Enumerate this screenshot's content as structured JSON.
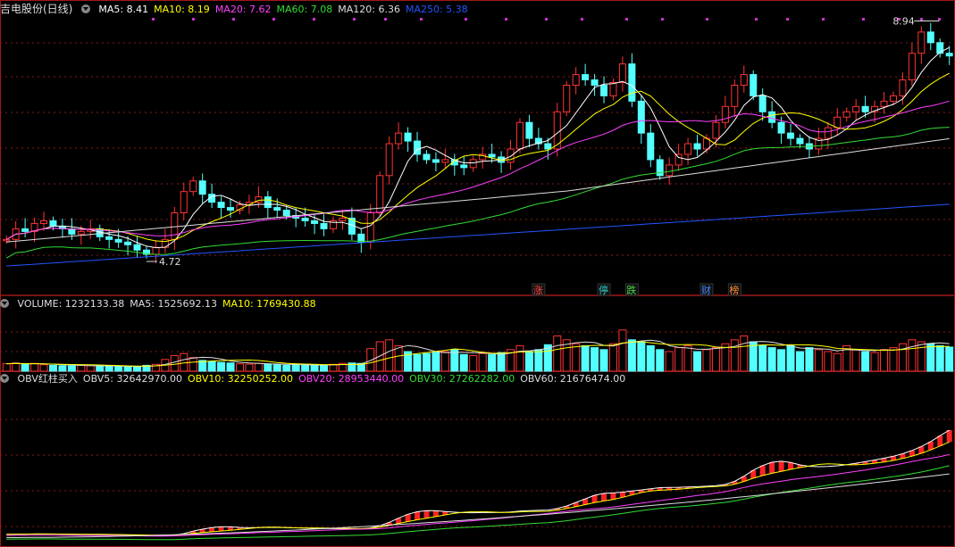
{
  "colors": {
    "up": "#ff3333",
    "down": "#54ffff",
    "ma5": "#ffffff",
    "ma10": "#ffff00",
    "ma20": "#ff40ff",
    "ma60": "#33dd33",
    "ma120": "#dddddd",
    "ma250": "#2255ff",
    "grid": "#8a1a1a",
    "border": "#a01818"
  },
  "price_panel": {
    "title": "吉电股份(日线)",
    "icon": "chevron-down-icon",
    "legend": [
      {
        "label": "MA5: 8.41",
        "color": "#ffffff"
      },
      {
        "label": "MA10: 8.19",
        "color": "#ffff00"
      },
      {
        "label": "MA20: 7.62",
        "color": "#ff40ff"
      },
      {
        "label": "MA60: 7.08",
        "color": "#33dd33"
      },
      {
        "label": "MA120: 6.36",
        "color": "#dddddd"
      },
      {
        "label": "MA250: 5.38",
        "color": "#2255ff"
      }
    ],
    "high_label": "8.94",
    "low_label": "4.72",
    "event_marks": [
      {
        "text": "涨",
        "color": "#ff4444",
        "day": 57
      },
      {
        "text": "停",
        "color": "#33cccc",
        "day": 64
      },
      {
        "text": "跌",
        "color": "#44dd44",
        "day": 67
      },
      {
        "text": "财",
        "color": "#4488ff",
        "day": 75
      },
      {
        "text": "榜",
        "color": "#ff8833",
        "day": 78
      }
    ]
  },
  "volume_panel": {
    "legend": [
      {
        "label": "VOLUME: 1232133.38",
        "color": "#dddddd"
      },
      {
        "label": "MA5: 1525692.13",
        "color": "#dddddd"
      },
      {
        "label": "MA10: 1769430.88",
        "color": "#ffff00"
      }
    ]
  },
  "obv_panel": {
    "legend": [
      {
        "label": "OBV红柱买入",
        "color": "#dddddd"
      },
      {
        "label": "OBV5: 32642970.00",
        "color": "#dddddd"
      },
      {
        "label": "OBV10: 32250252.00",
        "color": "#ffff00"
      },
      {
        "label": "OBV20: 28953440.00",
        "color": "#ff40ff"
      },
      {
        "label": "OBV30: 27262282.00",
        "color": "#33dd33"
      },
      {
        "label": "OBV60: 21676474.00",
        "color": "#dddddd"
      }
    ]
  },
  "chart_data": {
    "type": "candlestick",
    "price_range": [
      4.2,
      9.2
    ],
    "volume_range": [
      0,
      3000000
    ],
    "obv_range": [
      0,
      38000000
    ],
    "days": 102,
    "price_path": [
      5.0,
      5.2,
      5.15,
      5.3,
      5.35,
      5.25,
      5.2,
      5.1,
      5.15,
      5.2,
      5.05,
      5.0,
      4.95,
      4.9,
      4.8,
      4.72,
      4.85,
      5.0,
      5.5,
      5.9,
      6.1,
      5.85,
      5.7,
      5.6,
      5.55,
      5.65,
      5.7,
      5.8,
      5.6,
      5.55,
      5.45,
      5.4,
      5.35,
      5.3,
      5.2,
      5.35,
      5.4,
      5.1,
      4.95,
      5.5,
      6.2,
      6.8,
      7.0,
      6.85,
      6.6,
      6.5,
      6.45,
      6.5,
      6.4,
      6.35,
      6.5,
      6.6,
      6.55,
      6.45,
      6.7,
      7.2,
      6.9,
      6.8,
      6.7,
      7.4,
      7.9,
      8.1,
      8.0,
      7.9,
      7.7,
      7.95,
      8.3,
      7.6,
      7.0,
      6.5,
      6.2,
      6.4,
      6.6,
      6.8,
      6.7,
      6.9,
      7.2,
      7.5,
      7.9,
      8.1,
      7.7,
      7.4,
      7.2,
      7.0,
      6.9,
      6.8,
      6.7,
      6.9,
      7.1,
      7.3,
      7.4,
      7.5,
      7.4,
      7.5,
      7.6,
      7.7,
      8.0,
      8.5,
      8.9,
      8.7,
      8.5,
      8.45
    ],
    "volume_path": [
      0.38,
      0.42,
      0.35,
      0.4,
      0.33,
      0.3,
      0.28,
      0.27,
      0.3,
      0.28,
      0.26,
      0.25,
      0.24,
      0.22,
      0.25,
      0.3,
      0.35,
      0.6,
      0.8,
      0.9,
      0.7,
      0.55,
      0.5,
      0.45,
      0.42,
      0.38,
      0.36,
      0.4,
      0.35,
      0.33,
      0.3,
      0.32,
      0.34,
      0.3,
      0.3,
      0.35,
      0.4,
      0.42,
      0.4,
      1.15,
      1.5,
      1.6,
      1.3,
      1.0,
      0.85,
      0.9,
      0.95,
      1.0,
      1.1,
      0.85,
      0.8,
      0.9,
      0.85,
      0.95,
      1.1,
      1.3,
      1.0,
      1.1,
      1.35,
      1.8,
      1.6,
      1.4,
      1.3,
      1.2,
      1.1,
      1.4,
      2.1,
      1.6,
      1.5,
      1.3,
      1.1,
      1.0,
      1.2,
      1.3,
      1.0,
      1.1,
      1.2,
      1.4,
      1.6,
      1.8,
      1.5,
      1.3,
      1.2,
      1.1,
      1.3,
      1.0,
      1.2,
      1.1,
      1.0,
      0.9,
      1.3,
      1.1,
      1.0,
      0.95,
      1.1,
      1.2,
      1.4,
      1.6,
      1.5,
      1.4,
      1.3,
      1.23
    ],
    "obv_path": [
      2.0,
      2.1,
      2.05,
      2.15,
      2.1,
      2.0,
      1.95,
      1.9,
      1.95,
      2.0,
      1.9,
      1.85,
      1.8,
      1.7,
      1.6,
      1.5,
      1.6,
      1.8,
      2.5,
      3.5,
      4.5,
      4.0,
      3.6,
      3.5,
      3.55,
      3.65,
      3.7,
      3.8,
      3.6,
      3.55,
      3.5,
      3.45,
      3.4,
      3.35,
      3.3,
      3.4,
      3.45,
      3.3,
      3.2,
      4.5,
      6.0,
      7.5,
      8.4,
      8.0,
      7.6,
      7.4,
      7.3,
      7.4,
      7.2,
      7.1,
      7.3,
      7.5,
      7.4,
      7.3,
      7.6,
      8.5,
      8.0,
      7.8,
      7.6,
      9.5,
      11.5,
      12.3,
      12.2,
      12.0,
      11.8,
      12.1,
      13.2,
      13.5,
      13.4,
      13.3,
      13.4,
      13.5,
      13.6,
      13.8,
      13.7,
      13.9,
      14.3,
      15.0,
      17.5,
      20.0,
      21.2,
      20.0,
      19.0,
      18.7,
      18.5,
      18.3,
      18.2,
      18.6,
      19.0,
      19.3,
      19.6,
      20.0,
      20.5,
      21.0,
      21.5,
      22.0,
      23.0,
      24.5,
      25.8,
      27.5,
      29.2,
      29.8
    ]
  }
}
